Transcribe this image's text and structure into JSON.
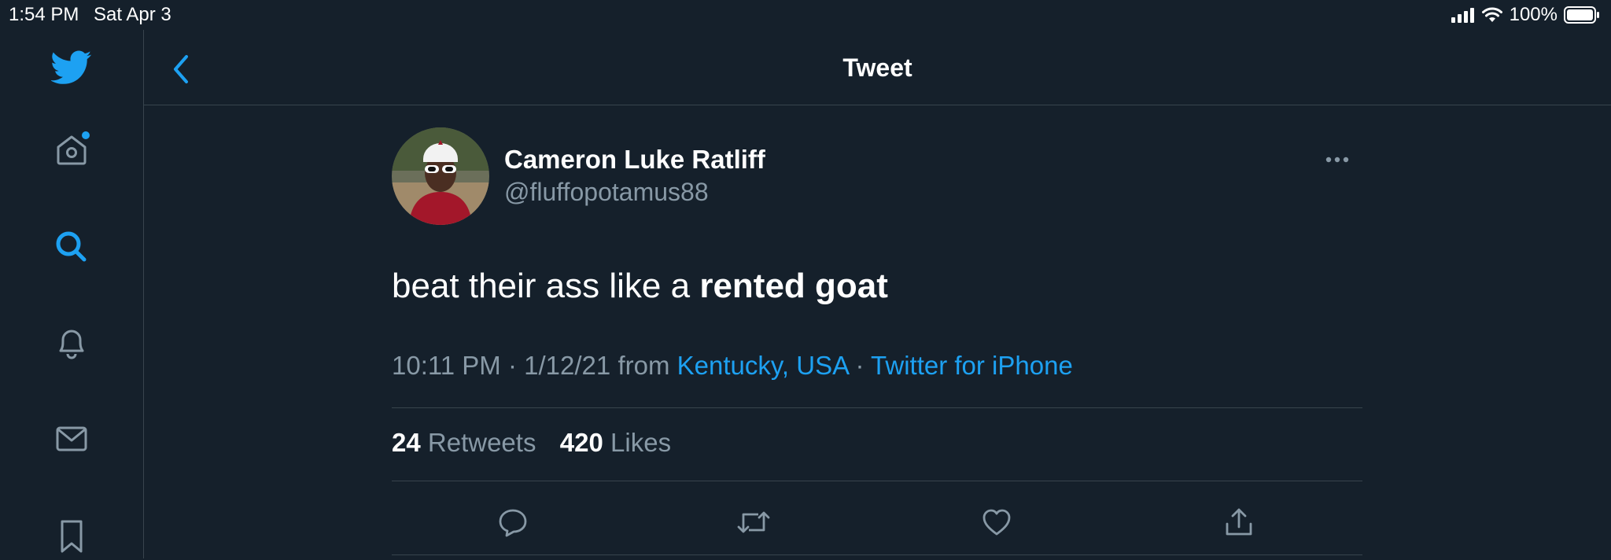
{
  "status_bar": {
    "time": "1:54 PM",
    "date": "Sat Apr 3",
    "battery_label": "100%"
  },
  "sidebar": {
    "items": [
      {
        "name": "twitter-logo",
        "icon": "twitter-bird-icon"
      },
      {
        "name": "home",
        "icon": "home-icon"
      },
      {
        "name": "explore",
        "icon": "search-icon"
      },
      {
        "name": "notifications",
        "icon": "bell-icon"
      },
      {
        "name": "messages",
        "icon": "mail-icon"
      },
      {
        "name": "bookmarks",
        "icon": "bookmark-icon"
      }
    ]
  },
  "header": {
    "title": "Tweet",
    "back_icon": "chevron-left-icon"
  },
  "tweet": {
    "display_name": "Cameron Luke Ratliff",
    "handle": "@fluffopotamus88",
    "text_plain": "beat their ass like a ",
    "text_bold": "rented goat",
    "time": "10:11 PM",
    "date": "1/12/21",
    "from_label": "from",
    "location": "Kentucky, USA",
    "client": "Twitter for iPhone",
    "retweets_count": "24",
    "retweets_label": "Retweets",
    "likes_count": "420",
    "likes_label": "Likes"
  },
  "colors": {
    "background": "#15202b",
    "accent": "#1da1f2",
    "secondary_text": "#8899a6",
    "divider": "#38444d"
  }
}
